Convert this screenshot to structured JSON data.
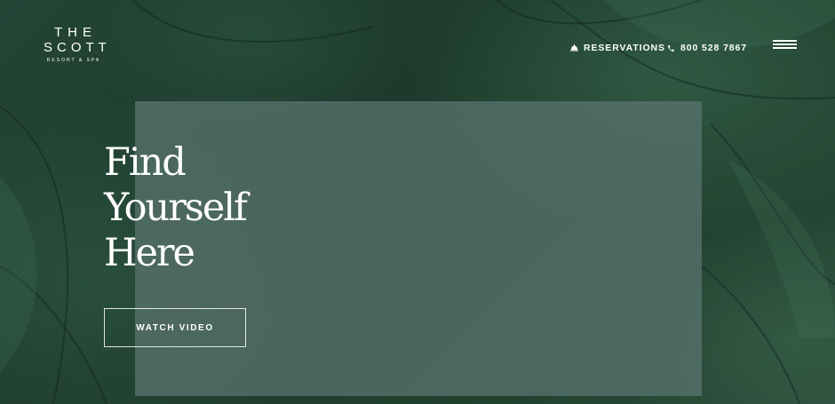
{
  "logo": {
    "line1": "THE",
    "line2": "SCOTT",
    "line3": "RESORT & SPA"
  },
  "nav": {
    "reservations": {
      "label": "RESERVATIONS",
      "icon": "bell-icon"
    },
    "phone": {
      "label": "800 528 7867",
      "icon": "phone-icon"
    },
    "menu_icon": "hamburger-menu-icon"
  },
  "hero": {
    "headline": [
      "Find",
      "Yourself",
      "Here"
    ],
    "cta_label": "WATCH VIDEO"
  },
  "colors": {
    "background": "#1f3d2f",
    "overlay": "#5b7672",
    "text": "#ffffff"
  }
}
